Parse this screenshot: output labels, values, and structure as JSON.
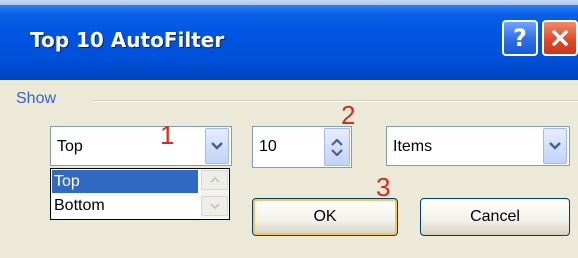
{
  "dialog": {
    "title": "Top 10 AutoFilter",
    "help_button_label": "?",
    "close_icon": "close-icon"
  },
  "show_group": {
    "label": "Show",
    "type_combo": {
      "selected": "Top",
      "options": [
        "Top",
        "Bottom"
      ],
      "highlighted_option": "Top"
    },
    "count_spinner": {
      "value": "10"
    },
    "unit_combo": {
      "selected": "Items"
    }
  },
  "buttons": {
    "ok_label": "OK",
    "cancel_label": "Cancel"
  },
  "annotations": {
    "one": "1",
    "two": "2",
    "three": "3"
  },
  "colors": {
    "title_bar": "#0054e3",
    "close_button": "#e0492a",
    "selection": "#316ac5",
    "annotation": "#d22d1f",
    "group_label": "#3466c4"
  }
}
